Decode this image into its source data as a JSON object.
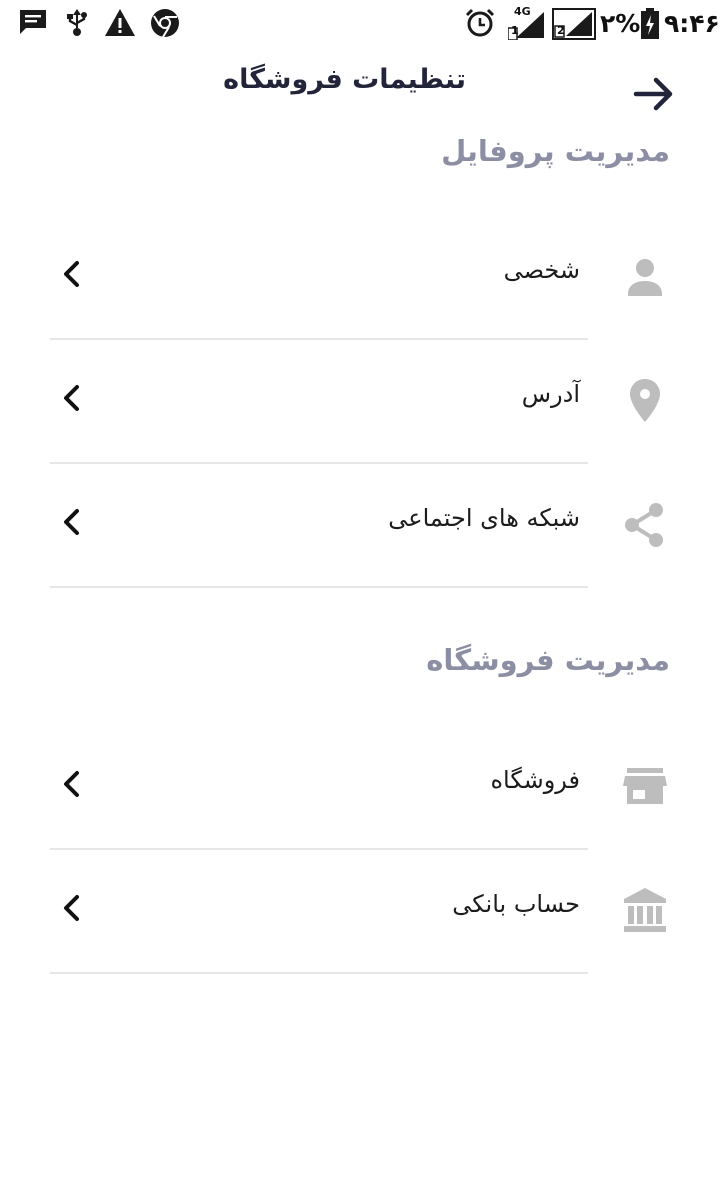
{
  "status_bar": {
    "time": "۹:۴۶",
    "battery_percent": "۲%",
    "network_label": "4G",
    "sim1": "1",
    "sim2": "2"
  },
  "header": {
    "title": "تنظیمات فروشگاه"
  },
  "sections": [
    {
      "title": "مدیریت پروفایل",
      "items": [
        {
          "label": "شخصی",
          "icon": "person-icon"
        },
        {
          "label": "آدرس",
          "icon": "location-pin-icon"
        },
        {
          "label": "شبکه های اجتماعی",
          "icon": "share-icon"
        }
      ]
    },
    {
      "title": "مدیریت فروشگاه",
      "items": [
        {
          "label": "فروشگاه",
          "icon": "store-icon"
        },
        {
          "label": "حساب بانکی",
          "icon": "bank-icon"
        }
      ]
    }
  ],
  "colors": {
    "title": "#22253a",
    "section_title": "#8c8fa3",
    "icon_gray": "#bdbdbd",
    "divider": "#e6e6e6"
  }
}
